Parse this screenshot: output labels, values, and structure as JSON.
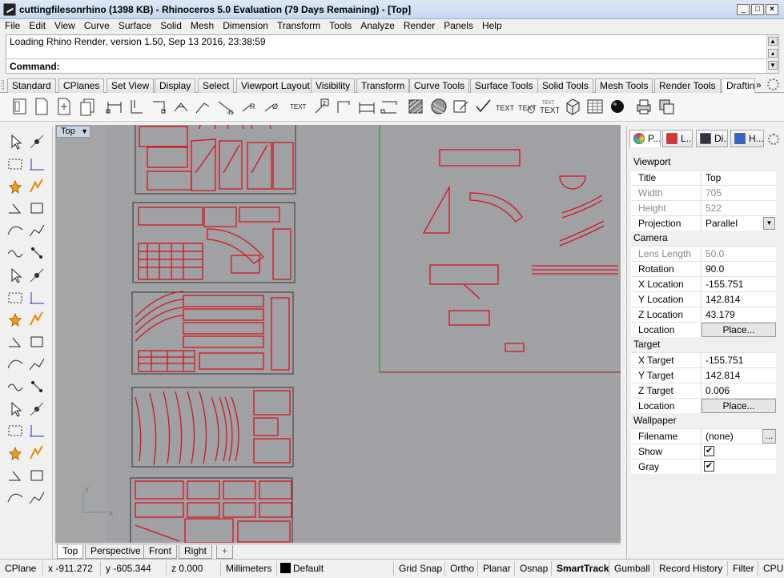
{
  "window": {
    "title": "cuttingfilesonrhino (1398 KB) - Rhinoceros 5.0 Evaluation (79 Days Remaining) - [Top]",
    "controls": [
      "_",
      "□",
      "×"
    ]
  },
  "menu": [
    "File",
    "Edit",
    "View",
    "Curve",
    "Surface",
    "Solid",
    "Mesh",
    "Dimension",
    "Transform",
    "Tools",
    "Analyze",
    "Render",
    "Panels",
    "Help"
  ],
  "command": {
    "history": "Loading Rhino Render, version 1.50, Sep 13 2016, 23:38:59",
    "label": "Command:",
    "value": ""
  },
  "toolbar_tabs": [
    "Standard",
    "CPlanes",
    "Set View",
    "Display",
    "Select",
    "Viewport Layout",
    "Visibility",
    "Transform",
    "Curve Tools",
    "Surface Tools",
    "Solid Tools",
    "Mesh Tools",
    "Render Tools",
    "Drafting"
  ],
  "toolbar_overflow": "»",
  "viewport": {
    "label": "Top",
    "tabs": [
      "Top",
      "Perspective",
      "Front",
      "Right"
    ],
    "add_tab": "+",
    "axis_x": "x",
    "axis_y": "y"
  },
  "panel": {
    "tabs": [
      {
        "label": "P...",
        "icon": "properties-icon"
      },
      {
        "label": "L...",
        "icon": "layers-icon"
      },
      {
        "label": "Di...",
        "icon": "display-icon"
      },
      {
        "label": "H...",
        "icon": "help-icon"
      }
    ],
    "sections": {
      "viewport": "Viewport",
      "camera": "Camera",
      "target": "Target",
      "wallpaper": "Wallpaper"
    },
    "viewport_rows": [
      {
        "label": "Title",
        "value": "Top",
        "dim": false
      },
      {
        "label": "Width",
        "value": "705",
        "dim": true
      },
      {
        "label": "Height",
        "value": "522",
        "dim": true
      },
      {
        "label": "Projection",
        "value": "Parallel",
        "dim": false
      }
    ],
    "camera_rows": [
      {
        "label": "Lens Length",
        "value": "50.0",
        "dim": true
      },
      {
        "label": "Rotation",
        "value": "90.0",
        "dim": false
      },
      {
        "label": "X Location",
        "value": "-155.751",
        "dim": false
      },
      {
        "label": "Y Location",
        "value": "142.814",
        "dim": false
      },
      {
        "label": "Z Location",
        "value": "43.179",
        "dim": false
      }
    ],
    "camera_location": {
      "label": "Location",
      "button": "Place..."
    },
    "target_rows": [
      {
        "label": "X Target",
        "value": "-155.751"
      },
      {
        "label": "Y Target",
        "value": "142.814"
      },
      {
        "label": "Z Target",
        "value": "0.006"
      }
    ],
    "target_location": {
      "label": "Location",
      "button": "Place..."
    },
    "wallpaper": {
      "filename_label": "Filename",
      "filename_value": "(none)",
      "browse": "...",
      "show_label": "Show",
      "show_checked": true,
      "gray_label": "Gray",
      "gray_checked": true
    }
  },
  "status": {
    "cplane": "CPlane",
    "x": "x -911.272",
    "y": "y -605.344",
    "z": "z 0.000",
    "units": "Millimeters",
    "layer": "Default",
    "toggles": [
      "Grid Snap",
      "Ortho",
      "Planar",
      "Osnap",
      "SmartTrack",
      "Gumball",
      "Record History",
      "Filter"
    ],
    "active_toggle": "SmartTrack",
    "bold_toggle": "SmartTrack",
    "extra": "CPU us"
  },
  "colors": {
    "curve_red": "#d4141c",
    "viewport_bg": "#9ea0a3",
    "green_axis": "#1faa1f"
  }
}
